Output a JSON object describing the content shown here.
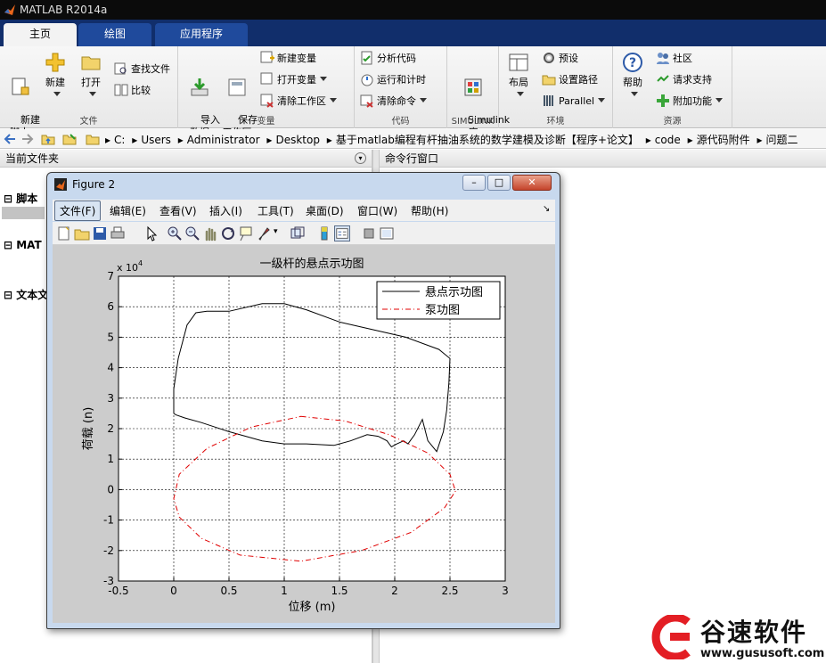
{
  "window": {
    "title": "MATLAB R2014a"
  },
  "tabs": [
    {
      "label": "主页",
      "active": true
    },
    {
      "label": "绘图",
      "active": false
    },
    {
      "label": "应用程序",
      "active": false
    }
  ],
  "ribbon": {
    "file": {
      "label": "文件",
      "new_script": "新建\n脚本",
      "new": "新建",
      "open": "打开",
      "find_files": "查找文件",
      "compare": "比较"
    },
    "variable": {
      "label": "变量",
      "import": "导入\n数据",
      "save_workspace": "保存\n工作区",
      "new_variable": "新建变量",
      "open_variable": "打开变量",
      "clear_workspace": "清除工作区"
    },
    "code": {
      "label": "代码",
      "analyze_code": "分析代码",
      "run_and_time": "运行和计时",
      "clear_commands": "清除命令"
    },
    "simulink": {
      "label": "SIMULINK",
      "button": "Simulink\n库"
    },
    "environment": {
      "label": "环境",
      "layout": "布局",
      "preferences": "预设",
      "set_path": "设置路径",
      "parallel": "Parallel"
    },
    "resources": {
      "label": "资源",
      "help": "帮助",
      "community": "社区",
      "request_support": "请求支持",
      "addons": "附加功能"
    }
  },
  "address": {
    "segments": [
      "C:",
      "Users",
      "Administrator",
      "Desktop",
      "基于matlab编程有杆抽油系统的数学建模及诊断【程序+论文】",
      "code",
      "源代码附件",
      "问题二"
    ]
  },
  "panels": {
    "current_folder": "当前文件夹",
    "command_window": "命令行窗口",
    "tree": [
      "脚本",
      "MAT",
      "文本文"
    ]
  },
  "figure": {
    "title": "Figure 2",
    "menu": [
      "文件(F)",
      "编辑(E)",
      "查看(V)",
      "插入(I)",
      "工具(T)",
      "桌面(D)",
      "窗口(W)",
      "帮助(H)"
    ]
  },
  "chart_data": {
    "type": "line",
    "title": "一级杆的悬点示功图",
    "xlabel": "位移 (m)",
    "ylabel": "荷载 (n)",
    "y_multiplier": "x 10^4",
    "xlim": [
      -0.5,
      3
    ],
    "ylim": [
      -3,
      7
    ],
    "xticks": [
      "-0.5",
      "0",
      "0.5",
      "1",
      "1.5",
      "2",
      "2.5",
      "3"
    ],
    "yticks": [
      "-3",
      "-2",
      "-1",
      "0",
      "1",
      "2",
      "3",
      "4",
      "5",
      "6",
      "7"
    ],
    "grid": true,
    "legend_position": "top-right",
    "series": [
      {
        "name": "悬点示功图",
        "color": "#000000",
        "style": "solid",
        "x": [
          0,
          0.04,
          0.12,
          0.2,
          0.3,
          0.5,
          0.8,
          1.0,
          1.2,
          1.5,
          1.8,
          2.1,
          2.4,
          2.5,
          2.49,
          2.47,
          2.44,
          2.38,
          2.3,
          2.25,
          2.18,
          2.12,
          2.08,
          2.02,
          1.97,
          1.93,
          1.85,
          1.75,
          1.6,
          1.45,
          1.2,
          1.0,
          0.8,
          0.5,
          0.25,
          0.1,
          0.02,
          0,
          0
        ],
        "y": [
          3.3,
          4.3,
          5.4,
          5.8,
          5.85,
          5.85,
          6.1,
          6.1,
          5.9,
          5.5,
          5.25,
          5.0,
          4.6,
          4.3,
          3.5,
          2.6,
          1.9,
          1.25,
          1.6,
          2.3,
          1.8,
          1.5,
          1.6,
          1.5,
          1.4,
          1.6,
          1.75,
          1.8,
          1.6,
          1.45,
          1.5,
          1.5,
          1.6,
          1.9,
          2.2,
          2.35,
          2.45,
          2.5,
          3.3
        ]
      },
      {
        "name": "泵功图",
        "color": "#e00000",
        "style": "dash-dot",
        "x": [
          1.15,
          1.55,
          1.95,
          2.3,
          2.5,
          2.55,
          2.45,
          2.15,
          1.7,
          1.15,
          0.6,
          0.25,
          0.05,
          0,
          0.05,
          0.3,
          0.7,
          1.15
        ],
        "y": [
          2.4,
          2.25,
          1.8,
          1.2,
          0.5,
          -0.05,
          -0.6,
          -1.4,
          -2.0,
          -2.35,
          -2.15,
          -1.6,
          -0.9,
          -0.3,
          0.5,
          1.35,
          2.05,
          2.4
        ]
      }
    ]
  },
  "watermark": {
    "name": "谷速软件",
    "url": "www.gususoft.com"
  }
}
